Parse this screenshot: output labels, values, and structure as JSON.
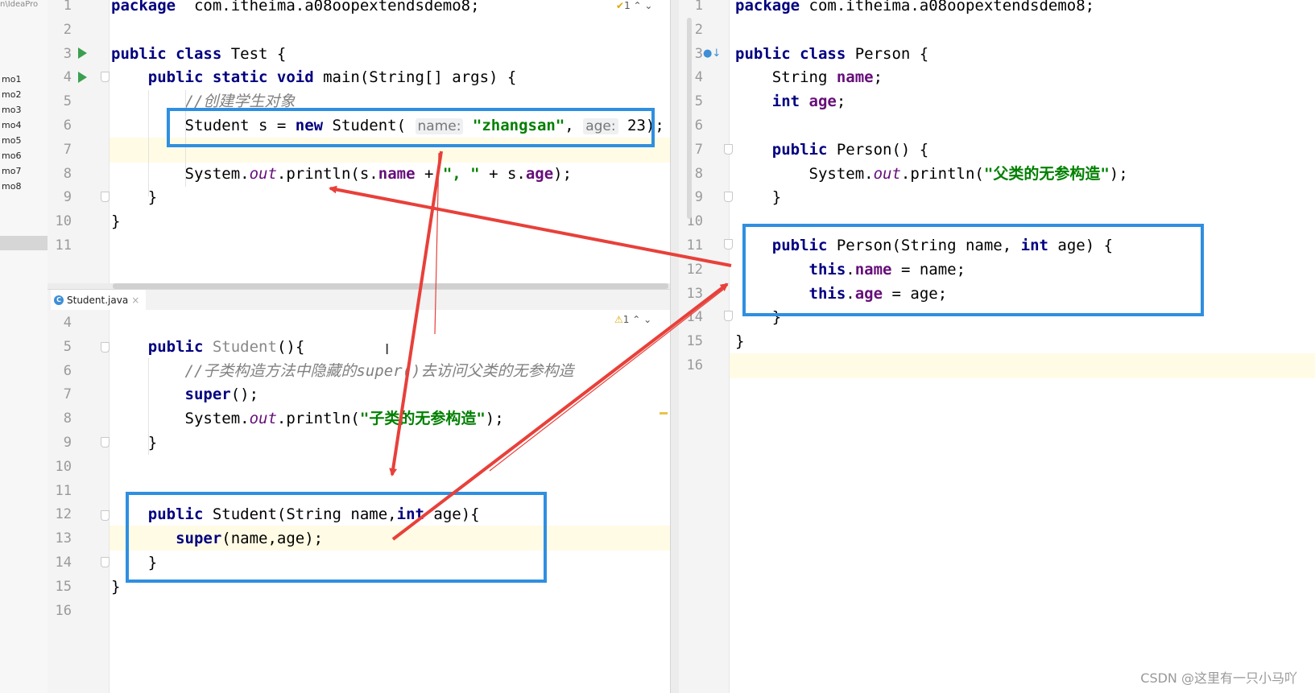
{
  "project_panel": {
    "path_fragment": "n\\IdeaPro",
    "modules": [
      "mo1",
      "mo2",
      "mo3",
      "mo4",
      "mo5",
      "mo6",
      "mo7",
      "mo8"
    ]
  },
  "test_editor": {
    "warning_count": "1",
    "lines": [
      {
        "n": "1",
        "tokens": [
          [
            "kw",
            "package"
          ],
          [
            "",
            "  com.itheima.a08oopextendsdemo8;"
          ]
        ]
      },
      {
        "n": "2",
        "tokens": []
      },
      {
        "n": "3",
        "tokens": [
          [
            "kw",
            "public class"
          ],
          [
            "",
            " Test {"
          ]
        ]
      },
      {
        "n": "4",
        "tokens": [
          [
            "",
            "    "
          ],
          [
            "kw",
            "public static void"
          ],
          [
            "",
            " main(String[] args) {"
          ]
        ]
      },
      {
        "n": "5",
        "tokens": [
          [
            "",
            "        "
          ],
          [
            "cm",
            "//创建学生对象"
          ]
        ]
      },
      {
        "n": "6",
        "tokens": [
          [
            "",
            "        Student s = "
          ],
          [
            "kw",
            "new"
          ],
          [
            "",
            " Student( "
          ],
          [
            "hint",
            "name:"
          ],
          [
            "",
            " "
          ],
          [
            "str",
            "\"zhangsan\""
          ],
          [
            "",
            ", "
          ],
          [
            "hint",
            "age:"
          ],
          [
            "",
            " 23);"
          ]
        ]
      },
      {
        "n": "7",
        "tokens": []
      },
      {
        "n": "8",
        "tokens": [
          [
            "",
            "        System."
          ],
          [
            "sfld",
            "out"
          ],
          [
            "",
            ".println(s."
          ],
          [
            "fld",
            "name"
          ],
          [
            "",
            " + "
          ],
          [
            "str",
            "\", \""
          ],
          [
            "",
            " + s."
          ],
          [
            "fld",
            "age"
          ],
          [
            "",
            ");"
          ]
        ]
      },
      {
        "n": "9",
        "tokens": [
          [
            "",
            "    }"
          ]
        ]
      },
      {
        "n": "10",
        "tokens": [
          [
            "",
            "}"
          ]
        ]
      },
      {
        "n": "11",
        "tokens": []
      }
    ]
  },
  "student_editor": {
    "tab_label": "Student.java",
    "tab_close": "×",
    "warning_count": "1",
    "lines": [
      {
        "n": "4",
        "tokens": []
      },
      {
        "n": "5",
        "tokens": [
          [
            "",
            "    "
          ],
          [
            "kw",
            "public"
          ],
          [
            "",
            " "
          ],
          [
            "gray",
            "Student"
          ],
          [
            "",
            "(){"
          ]
        ]
      },
      {
        "n": "6",
        "tokens": [
          [
            "",
            "        "
          ],
          [
            "cm",
            "//子类构造方法中隐藏的super()去访问父类的无参构造"
          ]
        ]
      },
      {
        "n": "7",
        "tokens": [
          [
            "",
            "        "
          ],
          [
            "kw",
            "super"
          ],
          [
            "",
            "();"
          ]
        ]
      },
      {
        "n": "8",
        "tokens": [
          [
            "",
            "        System."
          ],
          [
            "sfld",
            "out"
          ],
          [
            "",
            ".println("
          ],
          [
            "str",
            "\"子类的无参构造\""
          ],
          [
            "",
            ");"
          ]
        ]
      },
      {
        "n": "9",
        "tokens": [
          [
            "",
            "    }"
          ]
        ]
      },
      {
        "n": "10",
        "tokens": []
      },
      {
        "n": "11",
        "tokens": []
      },
      {
        "n": "12",
        "tokens": [
          [
            "",
            "    "
          ],
          [
            "kw",
            "public"
          ],
          [
            "",
            " Student(String name,"
          ],
          [
            "kw",
            "int"
          ],
          [
            "",
            " age){"
          ]
        ]
      },
      {
        "n": "13",
        "tokens": [
          [
            "",
            "       "
          ],
          [
            "kw",
            "super"
          ],
          [
            "",
            "(name,age);"
          ]
        ]
      },
      {
        "n": "14",
        "tokens": [
          [
            "",
            "    }"
          ]
        ]
      },
      {
        "n": "15",
        "tokens": [
          [
            "",
            "}"
          ]
        ]
      },
      {
        "n": "16",
        "tokens": []
      }
    ]
  },
  "person_editor": {
    "lines": [
      {
        "n": "1",
        "tokens": [
          [
            "kw",
            "package"
          ],
          [
            "",
            " com.itheima.a08oopextendsdemo8;"
          ]
        ]
      },
      {
        "n": "2",
        "tokens": []
      },
      {
        "n": "3",
        "tokens": [
          [
            "kw",
            "public class"
          ],
          [
            "",
            " Person {"
          ]
        ]
      },
      {
        "n": "4",
        "tokens": [
          [
            "",
            "    String "
          ],
          [
            "fld",
            "name"
          ],
          [
            "",
            ";"
          ]
        ]
      },
      {
        "n": "5",
        "tokens": [
          [
            "",
            "    "
          ],
          [
            "kw",
            "int"
          ],
          [
            "",
            " "
          ],
          [
            "fld",
            "age"
          ],
          [
            "",
            ";"
          ]
        ]
      },
      {
        "n": "6",
        "tokens": []
      },
      {
        "n": "7",
        "tokens": [
          [
            "",
            "    "
          ],
          [
            "kw",
            "public"
          ],
          [
            "",
            " Person() {"
          ]
        ]
      },
      {
        "n": "8",
        "tokens": [
          [
            "",
            "        System."
          ],
          [
            "sfld",
            "out"
          ],
          [
            "",
            ".println("
          ],
          [
            "str",
            "\"父类的无参构造\""
          ],
          [
            "",
            ");"
          ]
        ]
      },
      {
        "n": "9",
        "tokens": [
          [
            "",
            "    }"
          ]
        ]
      },
      {
        "n": "10",
        "tokens": []
      },
      {
        "n": "11",
        "tokens": [
          [
            "",
            "    "
          ],
          [
            "kw",
            "public"
          ],
          [
            "",
            " Person(String name, "
          ],
          [
            "kw",
            "int"
          ],
          [
            "",
            " age) {"
          ]
        ]
      },
      {
        "n": "12",
        "tokens": [
          [
            "",
            "        "
          ],
          [
            "kw",
            "this"
          ],
          [
            "",
            "."
          ],
          [
            "fld",
            "name"
          ],
          [
            "",
            " = name;"
          ]
        ]
      },
      {
        "n": "13",
        "tokens": [
          [
            "",
            "        "
          ],
          [
            "kw",
            "this"
          ],
          [
            "",
            "."
          ],
          [
            "fld",
            "age"
          ],
          [
            "",
            " = age;"
          ]
        ]
      },
      {
        "n": "14",
        "tokens": [
          [
            "",
            "    }"
          ]
        ]
      },
      {
        "n": "15",
        "tokens": [
          [
            "",
            "}"
          ]
        ]
      },
      {
        "n": "16",
        "tokens": []
      }
    ]
  },
  "annotations": {
    "box_color": "#2f8fe0",
    "arrow_color": "#e8403a"
  },
  "watermark": "CSDN @这里有一只小马吖"
}
